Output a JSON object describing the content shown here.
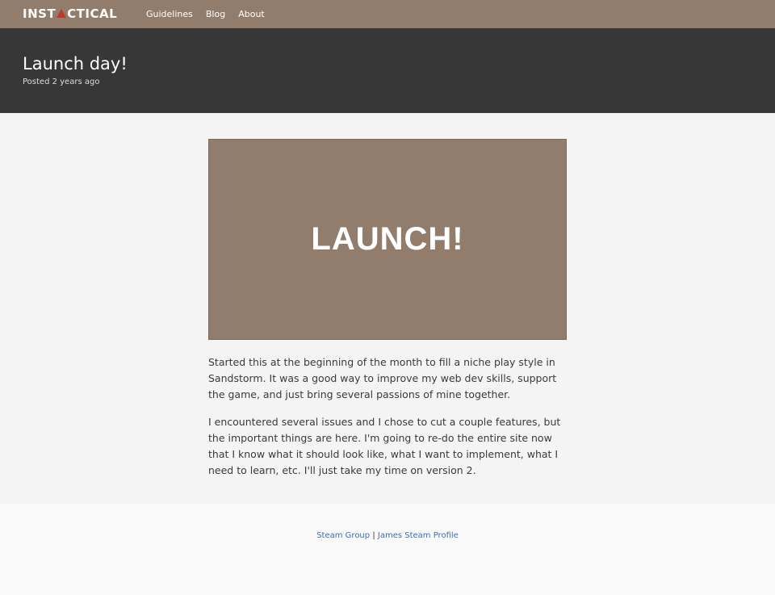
{
  "nav": {
    "logo_left": "INST",
    "logo_right": "CTICAL",
    "links": [
      "Guidelines",
      "Blog",
      "About"
    ]
  },
  "post": {
    "title": "Launch day!",
    "meta": "Posted 2 years ago",
    "hero_text": "LAUNCH!",
    "paragraphs": [
      "Started this at the beginning of the month to fill a niche play style in Sandstorm. It was a good way to improve my web dev skills, support the game, and just bring several passions of mine together.",
      "I encountered several issues and I chose to cut a couple features, but the important things are here. I'm going to re-do the entire site now that I know what it should look like, what I want to implement, what I need to learn, etc. I'll just take my time on version 2."
    ]
  },
  "footer": {
    "link1": "Steam Group",
    "separator": "|",
    "link2": "James Steam Profile"
  },
  "colors": {
    "nav_bg": "#927d6d",
    "header_bg": "#373737",
    "logo_accent": "#c0392b",
    "link": "#3a6fb5"
  }
}
